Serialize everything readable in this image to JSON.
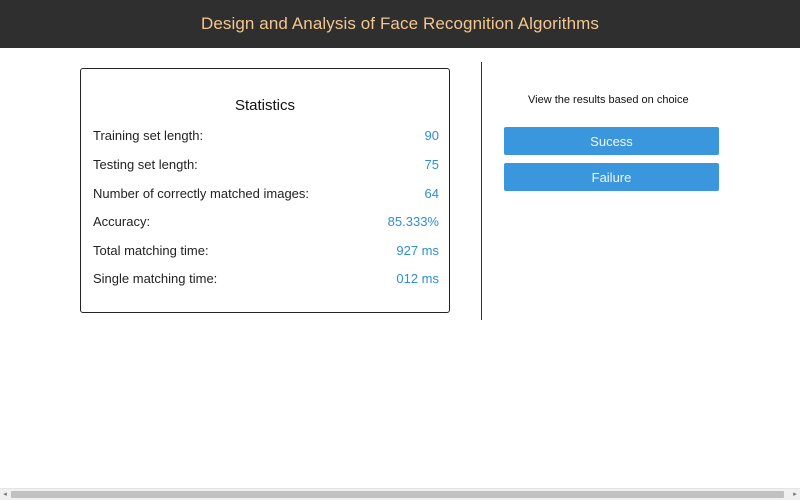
{
  "header": {
    "title": "Design and Analysis of Face Recognition Algorithms"
  },
  "statistics": {
    "title": "Statistics",
    "rows": [
      {
        "label": "Training set length:",
        "value": "90"
      },
      {
        "label": "Testing set length:",
        "value": "75"
      },
      {
        "label": "Number of correctly matched images:",
        "value": "64"
      },
      {
        "label": "Accuracy:",
        "value": "85.333%"
      },
      {
        "label": "Total matching time:",
        "value": "927 ms"
      },
      {
        "label": "Single matching time:",
        "value": "012 ms"
      }
    ]
  },
  "results": {
    "prompt": "View the results based on choice",
    "success_label": "Sucess",
    "failure_label": "Failure"
  },
  "scrollbar": {
    "left_arrow": "◂",
    "right_arrow": "▸"
  },
  "colors": {
    "header_bg": "#2f2f2f",
    "header_text": "#f2c68f",
    "value_text": "#2f8fd6",
    "button_bg": "#3a96dd"
  }
}
